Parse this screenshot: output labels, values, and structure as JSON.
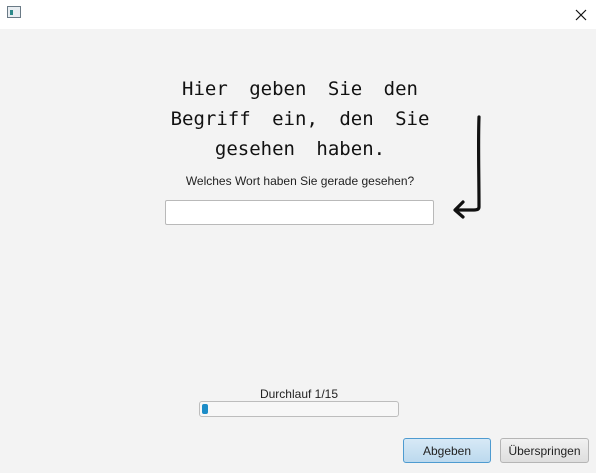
{
  "window": {
    "icon": "app-window-icon",
    "close_icon": "close-icon"
  },
  "main": {
    "instruction": "Hier geben Sie den Begriff ein, den Sie gesehen haben.",
    "arrow_icon": "arrow-down-left-icon",
    "question": "Welches Wort haben Sie gerade gesehen?",
    "answer_value": "",
    "answer_placeholder": ""
  },
  "progress": {
    "label": "Durchlauf 1/15",
    "current": 1,
    "total": 15,
    "accent_color": "#1c8cc7"
  },
  "buttons": {
    "submit_label": "Abgeben",
    "skip_label": "Überspringen"
  }
}
